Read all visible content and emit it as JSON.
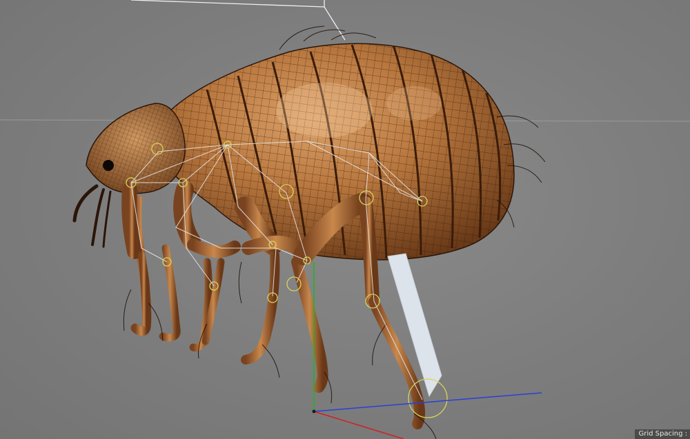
{
  "viewport": {
    "grid_spacing_label": "Grid Spacing :",
    "colors": {
      "background": "#7f7f7f",
      "body_light": "#d49a5e",
      "body_mid": "#b07038",
      "body_dark": "#5e3314",
      "mesh_line": "#2b160a",
      "rig_line": "#e6e6e6",
      "joint_ring": "#d8d45a",
      "axis_x": "#d12020",
      "axis_y": "#1fb51f",
      "axis_z": "#2b3fd8",
      "selected_bone": "#dde3ea"
    }
  },
  "scene": {
    "object": "flea-model",
    "icons": [
      "selected-bone",
      "joint-ring",
      "axis-gizmo"
    ]
  }
}
